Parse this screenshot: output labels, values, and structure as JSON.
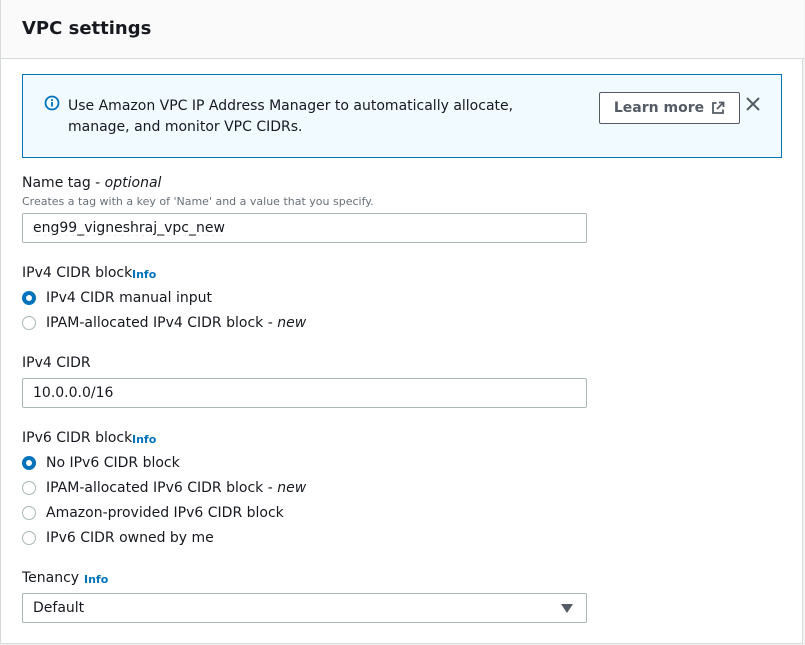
{
  "section": {
    "title": "VPC settings"
  },
  "alert": {
    "icon": "info-icon",
    "message": "Use Amazon VPC IP Address Manager to automatically allocate, manage, and monitor VPC CIDRs.",
    "button_label": "Learn more",
    "button_icon": "external-link-icon",
    "dismiss_icon": "close-icon"
  },
  "name_tag": {
    "label": "Name tag - ",
    "label_suffix": "optional",
    "description": "Creates a tag with a key of 'Name' and a value that you specify.",
    "value": "eng99_vigneshraj_vpc_new"
  },
  "ipv4_block": {
    "label": "IPv4 CIDR block",
    "info": "Info",
    "options": [
      {
        "label": "IPv4 CIDR manual input",
        "suffix": "",
        "checked": true
      },
      {
        "label": "IPAM-allocated IPv4 CIDR block - ",
        "suffix": "new",
        "checked": false
      }
    ]
  },
  "ipv4_cidr": {
    "label": "IPv4 CIDR",
    "value": "10.0.0.0/16"
  },
  "ipv6_block": {
    "label": "IPv6 CIDR block",
    "info": "Info",
    "options": [
      {
        "label": "No IPv6 CIDR block",
        "suffix": "",
        "checked": true
      },
      {
        "label": "IPAM-allocated IPv6 CIDR block - ",
        "suffix": "new",
        "checked": false
      },
      {
        "label": "Amazon-provided IPv6 CIDR block",
        "suffix": "",
        "checked": false
      },
      {
        "label": "IPv6 CIDR owned by me",
        "suffix": "",
        "checked": false
      }
    ]
  },
  "tenancy": {
    "label": "Tenancy",
    "info": "Info",
    "selected": "Default"
  },
  "colors": {
    "accent": "#0073bb",
    "alert_bg": "#f1faff",
    "header_bg": "#fafafa"
  }
}
